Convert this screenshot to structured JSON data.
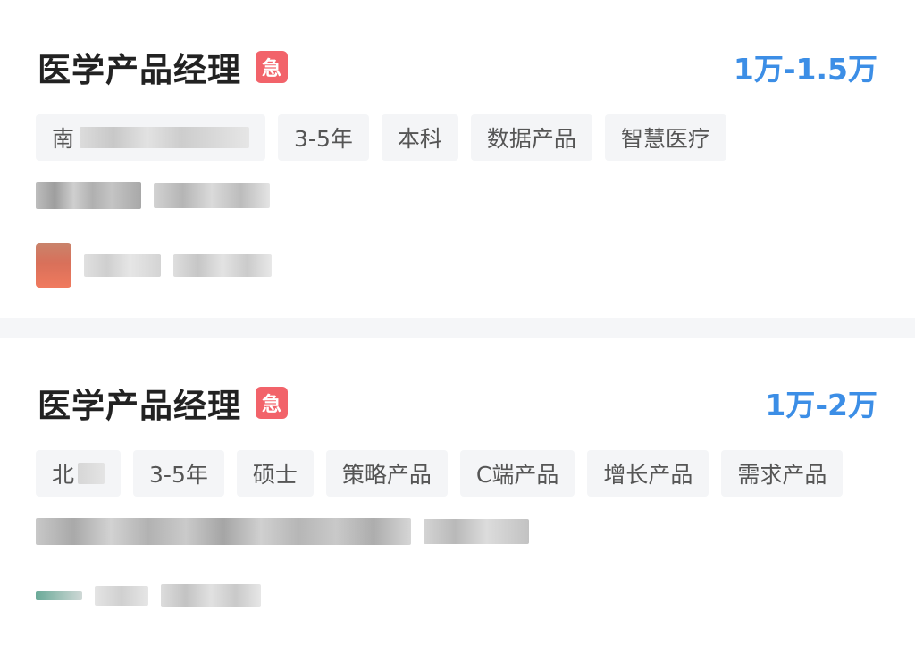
{
  "jobs": [
    {
      "title": "医学产品经理",
      "urgent_label": "急",
      "salary": "1万-1.5万",
      "tags": [
        "南",
        "3-5年",
        "本科",
        "数据产品",
        "智慧医疗"
      ]
    },
    {
      "title": "医学产品经理",
      "urgent_label": "急",
      "salary": "1万-2万",
      "tags": [
        "北",
        "3-5年",
        "硕士",
        "策略产品",
        "C端产品",
        "增长产品",
        "需求产品"
      ]
    }
  ],
  "colors": {
    "title": "#222222",
    "salary": "#3c8ee6",
    "urgent_badge": "#f2636a",
    "tag_bg": "#f4f5f7",
    "tag_text": "#555555",
    "divider": "#f5f6f8"
  }
}
